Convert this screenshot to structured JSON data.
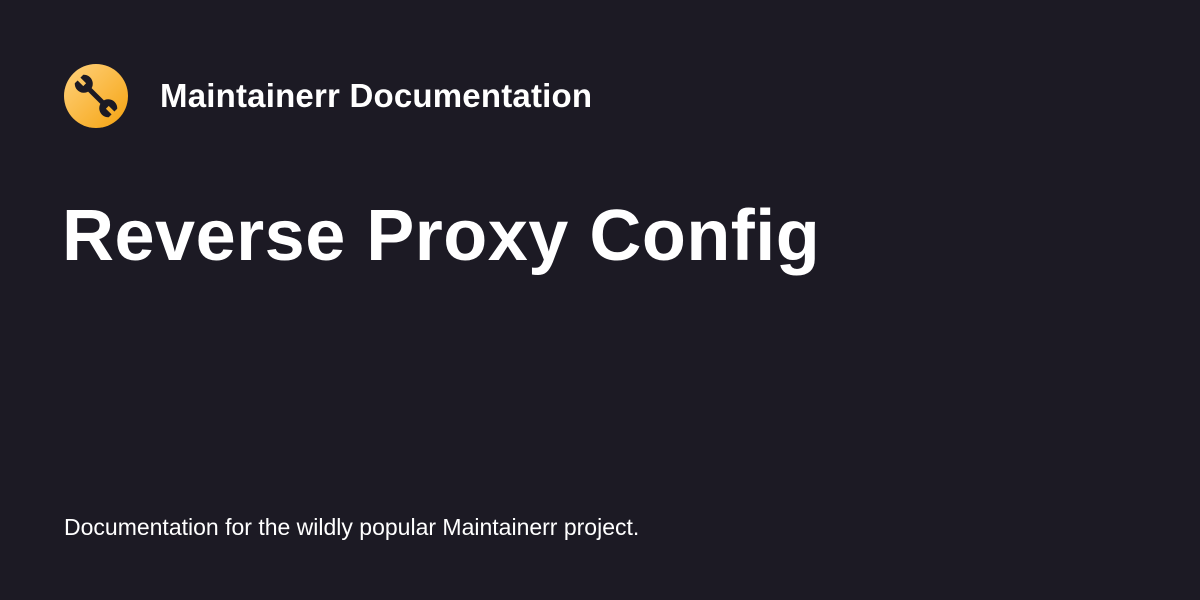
{
  "site": {
    "name": "Maintainerr Documentation",
    "logo_icon": "wrench-icon",
    "logo_colors": [
      "#ffd27e",
      "#f5a30f"
    ]
  },
  "page": {
    "title": "Reverse Proxy Config",
    "description": "Documentation for the wildly popular Maintainerr project."
  },
  "colors": {
    "background": "#1c1a24",
    "text": "#ffffff"
  }
}
